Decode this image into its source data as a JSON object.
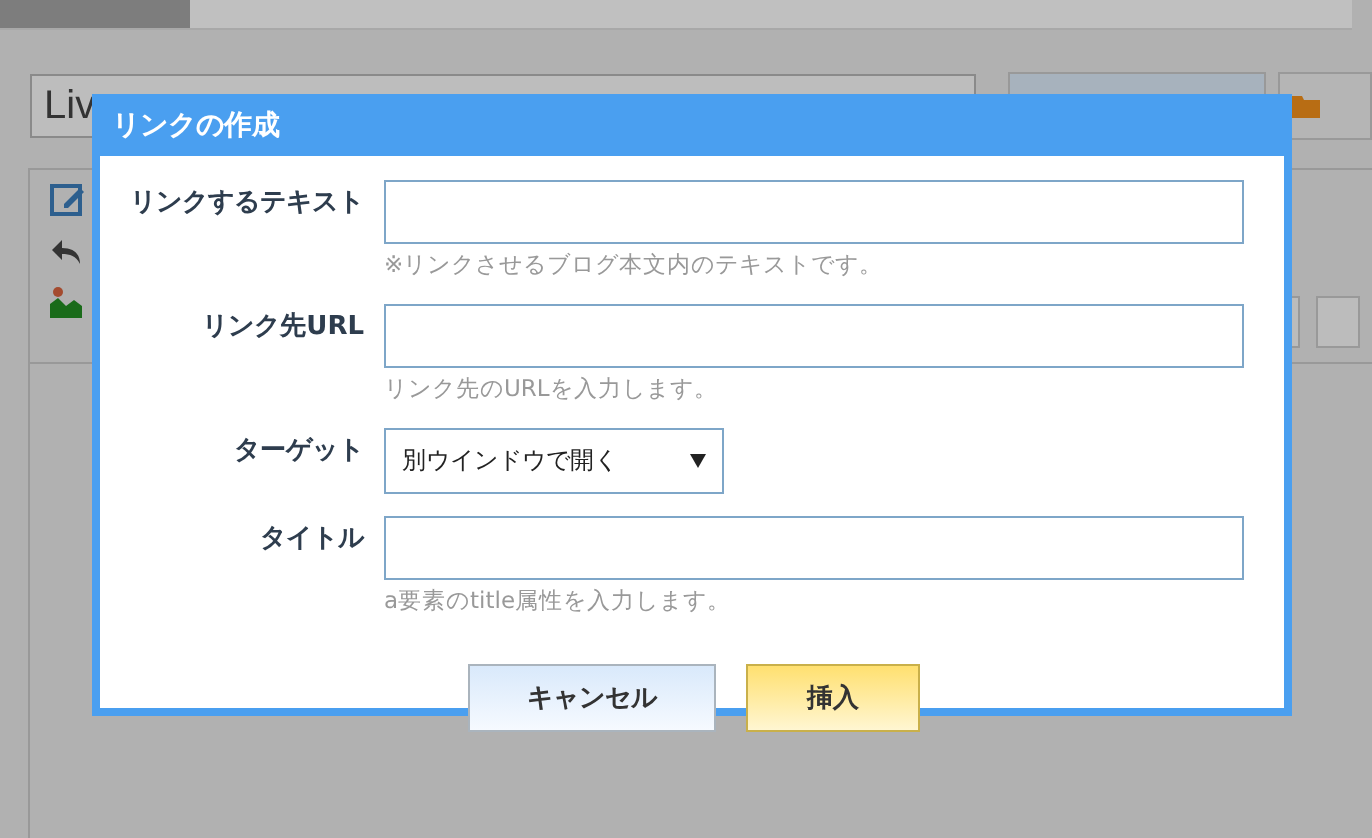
{
  "page": {
    "title_value": "Liv"
  },
  "dialog": {
    "title": "リンクの作成",
    "fields": [
      {
        "kind": "text",
        "label": "リンクするテキスト",
        "hint": "※リンクさせるブログ本文内のテキストです。"
      },
      {
        "kind": "text",
        "label": "リンク先URL",
        "hint": "リンク先のURLを入力します。"
      },
      {
        "kind": "select",
        "label": "ターゲット",
        "value": "別ウインドウで開く"
      },
      {
        "kind": "text",
        "label": "タイトル",
        "hint": "a要素のtitle属性を入力します。"
      }
    ],
    "buttons": [
      {
        "label": "キャンセル",
        "kind": "cancel"
      },
      {
        "label": "挿入",
        "kind": "primary"
      }
    ]
  }
}
